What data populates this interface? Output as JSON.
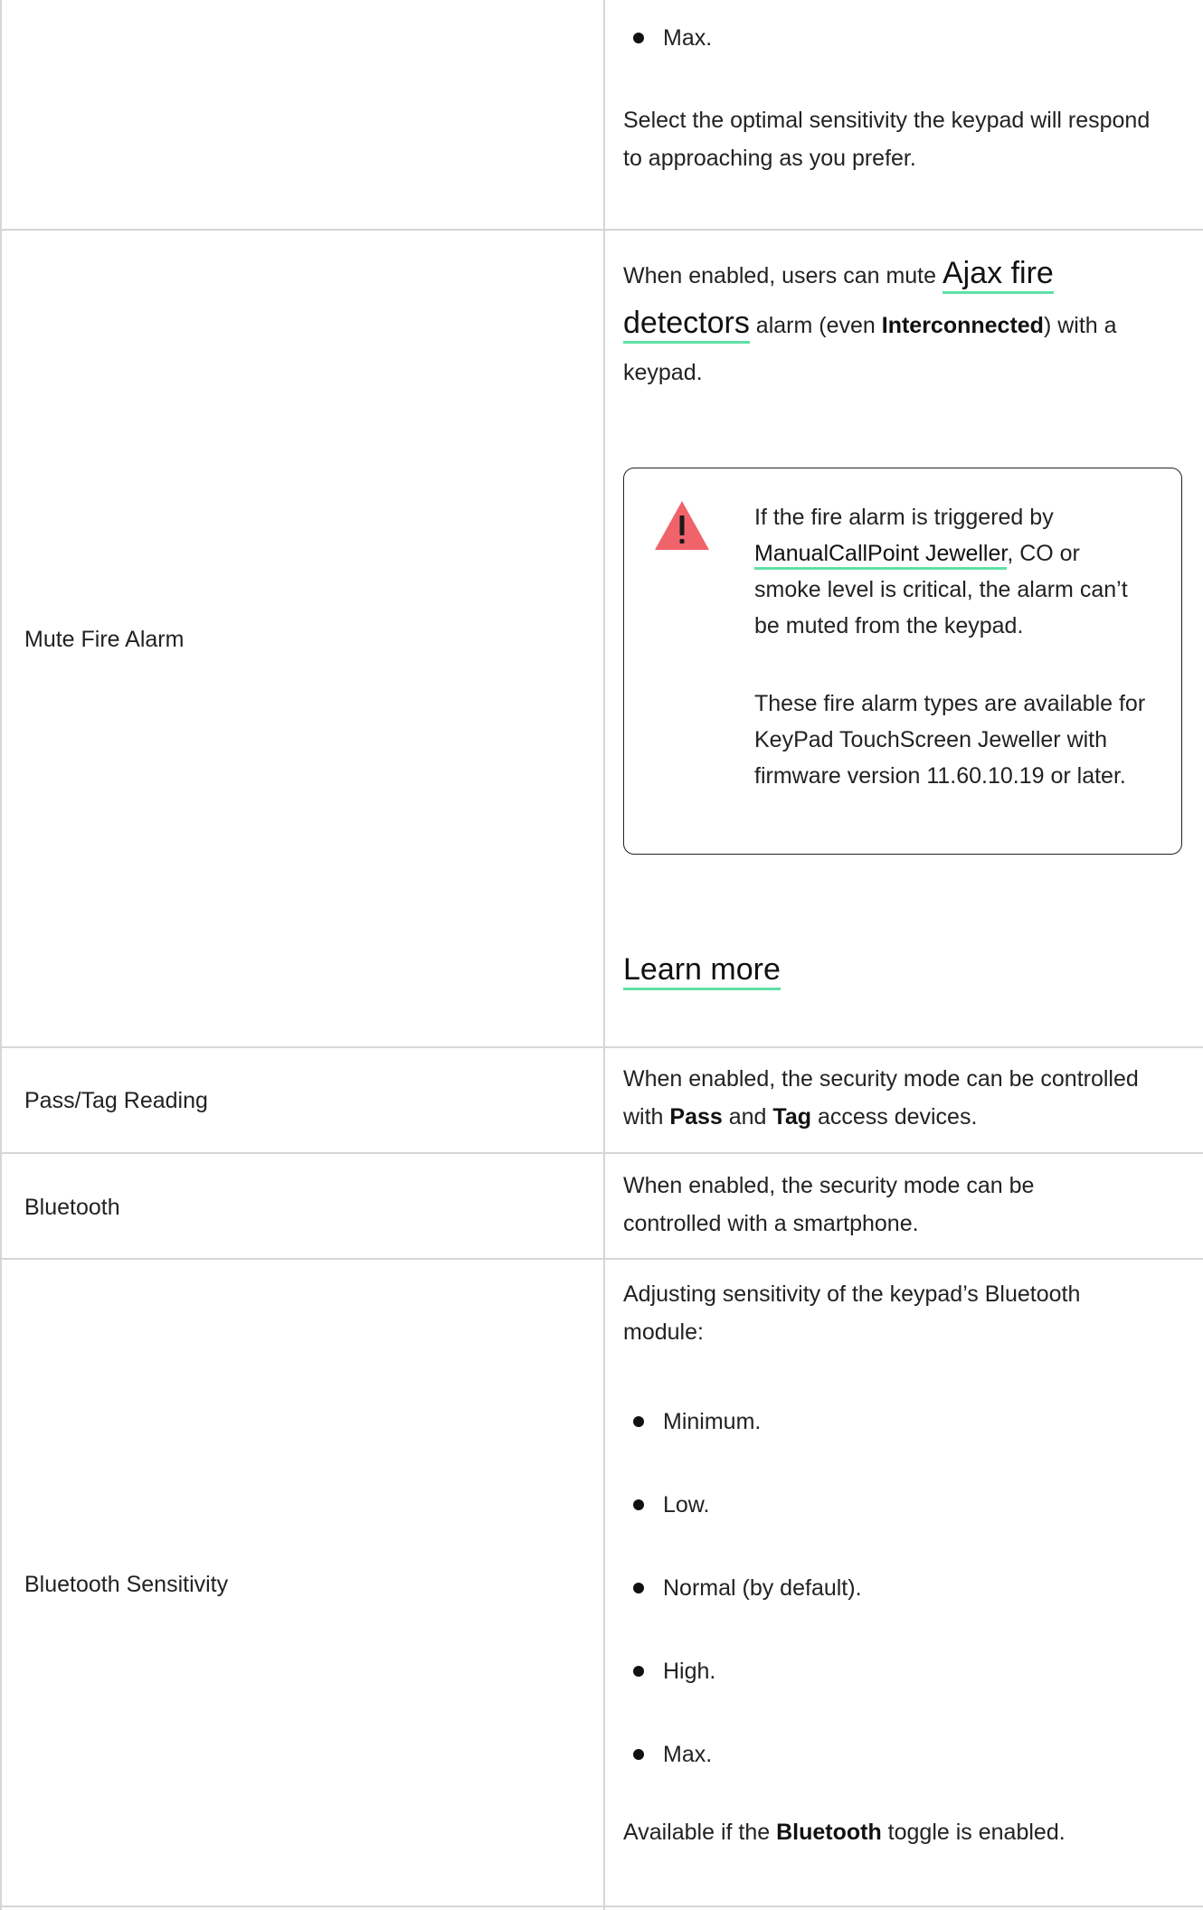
{
  "rows": {
    "sensitivity_cont": {
      "bullet_max": "Max.",
      "description": "Select the optimal sensitivity the keypad will respond to approaching as you prefer."
    },
    "mute_fire": {
      "label": "Mute Fire Alarm",
      "p1_before": "When enabled, users can mute ",
      "p1_link": "Ajax fire detectors",
      "p1_mid": " alarm (even ",
      "p1_bold": "Interconnected",
      "p1_after": ") with a keypad.",
      "note_link": "ManualCallPoint Jeweller",
      "note_text_after": ", CO or smoke level is critical, the alarm can’t be muted from the keypad.",
      "note_text_before": "If the fire alarm is triggered by ",
      "note_p2": "These fire alarm types are available for KeyPad TouchScreen Jeweller with firmware version 11.60.10.19 or later.",
      "learn_more": "Learn more"
    },
    "pass_tag": {
      "label": "Pass/Tag Reading",
      "before": "When enabled, the security mode can be controlled with ",
      "bold1": "Pass",
      "mid": " and ",
      "bold2": "Tag",
      "after": " access devices."
    },
    "bluetooth": {
      "label": "Bluetooth",
      "text": "When enabled, the security mode can be controlled with a smartphone."
    },
    "bt_sensitivity": {
      "label": "Bluetooth Sensitivity",
      "intro": "Adjusting sensitivity of the keypad’s Bluetooth module:",
      "bullets": [
        "Minimum.",
        "Low.",
        "Normal (by default).",
        "High.",
        "Max."
      ],
      "avail_before": "Available if the ",
      "avail_bold": "Bluetooth",
      "avail_after": " toggle is enabled."
    }
  },
  "colors": {
    "link_underline": "#5fe0a6",
    "warning": "#f0636b",
    "border": "#d6d6d6"
  },
  "icons": {
    "warning": "warning-triangle-icon"
  }
}
